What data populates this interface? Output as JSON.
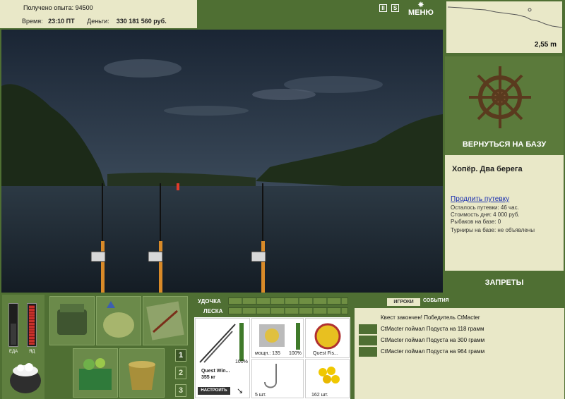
{
  "info": {
    "exp_label": "Получено опыта:",
    "exp_value": "94500",
    "time_label": "Время:",
    "time_value": "23:10 ПТ",
    "money_label": "Деньги:",
    "money_value": "330 181 560 руб."
  },
  "topbar": {
    "pause_icon": "II",
    "sound_icon": "S",
    "menu_label": "МЕНЮ"
  },
  "depth": {
    "value": "2,55 m"
  },
  "base": {
    "return_label": "ВЕРНУТЬСЯ НА БАЗУ",
    "location_title": "Хопёр. Два берега",
    "extend_link": "Продлить путевку",
    "remaining": "Осталось путевки: 46 час.",
    "day_cost": "Стоимость дня: 4 000 руб.",
    "fishers": "Рыбаков на базе: 0",
    "tournaments": "Турниры на базе: не объявлены",
    "bans_label": "ЗАПРЕТЫ"
  },
  "meters": {
    "food_label": "ЕДА",
    "poison_label": "ЯД"
  },
  "pages": [
    "1",
    "2",
    "3"
  ],
  "gear": {
    "rod_label": "УДОЧКА",
    "line_label": "ЛЕСКА",
    "rod_name": "Quest Win...",
    "rod_weight": "355 кг",
    "rod_percent": "100%",
    "setup_button": "НАСТРОИТЬ",
    "reel_power": "мощн.: 135",
    "reel_percent": "100%",
    "line_name": "Quest Fis...",
    "hook_count": "5 шт.",
    "bait_count": "162 шт."
  },
  "chat": {
    "tab_players": "ИГРОКИ",
    "tab_events": "СОБЫТИЯ",
    "quest": "Квест закончен! Победитель CtMacter",
    "events": [
      "CtMacter поймал Подуста на 118 грамм",
      "CtMacter поймал Подуста на 300 грамм",
      "CtMacter поймал Подуста на 964 грамм"
    ]
  },
  "colors": {
    "panel_green": "#4f6f33",
    "panel_cream": "#e9e8c8",
    "link_blue": "#1a2fb0"
  }
}
